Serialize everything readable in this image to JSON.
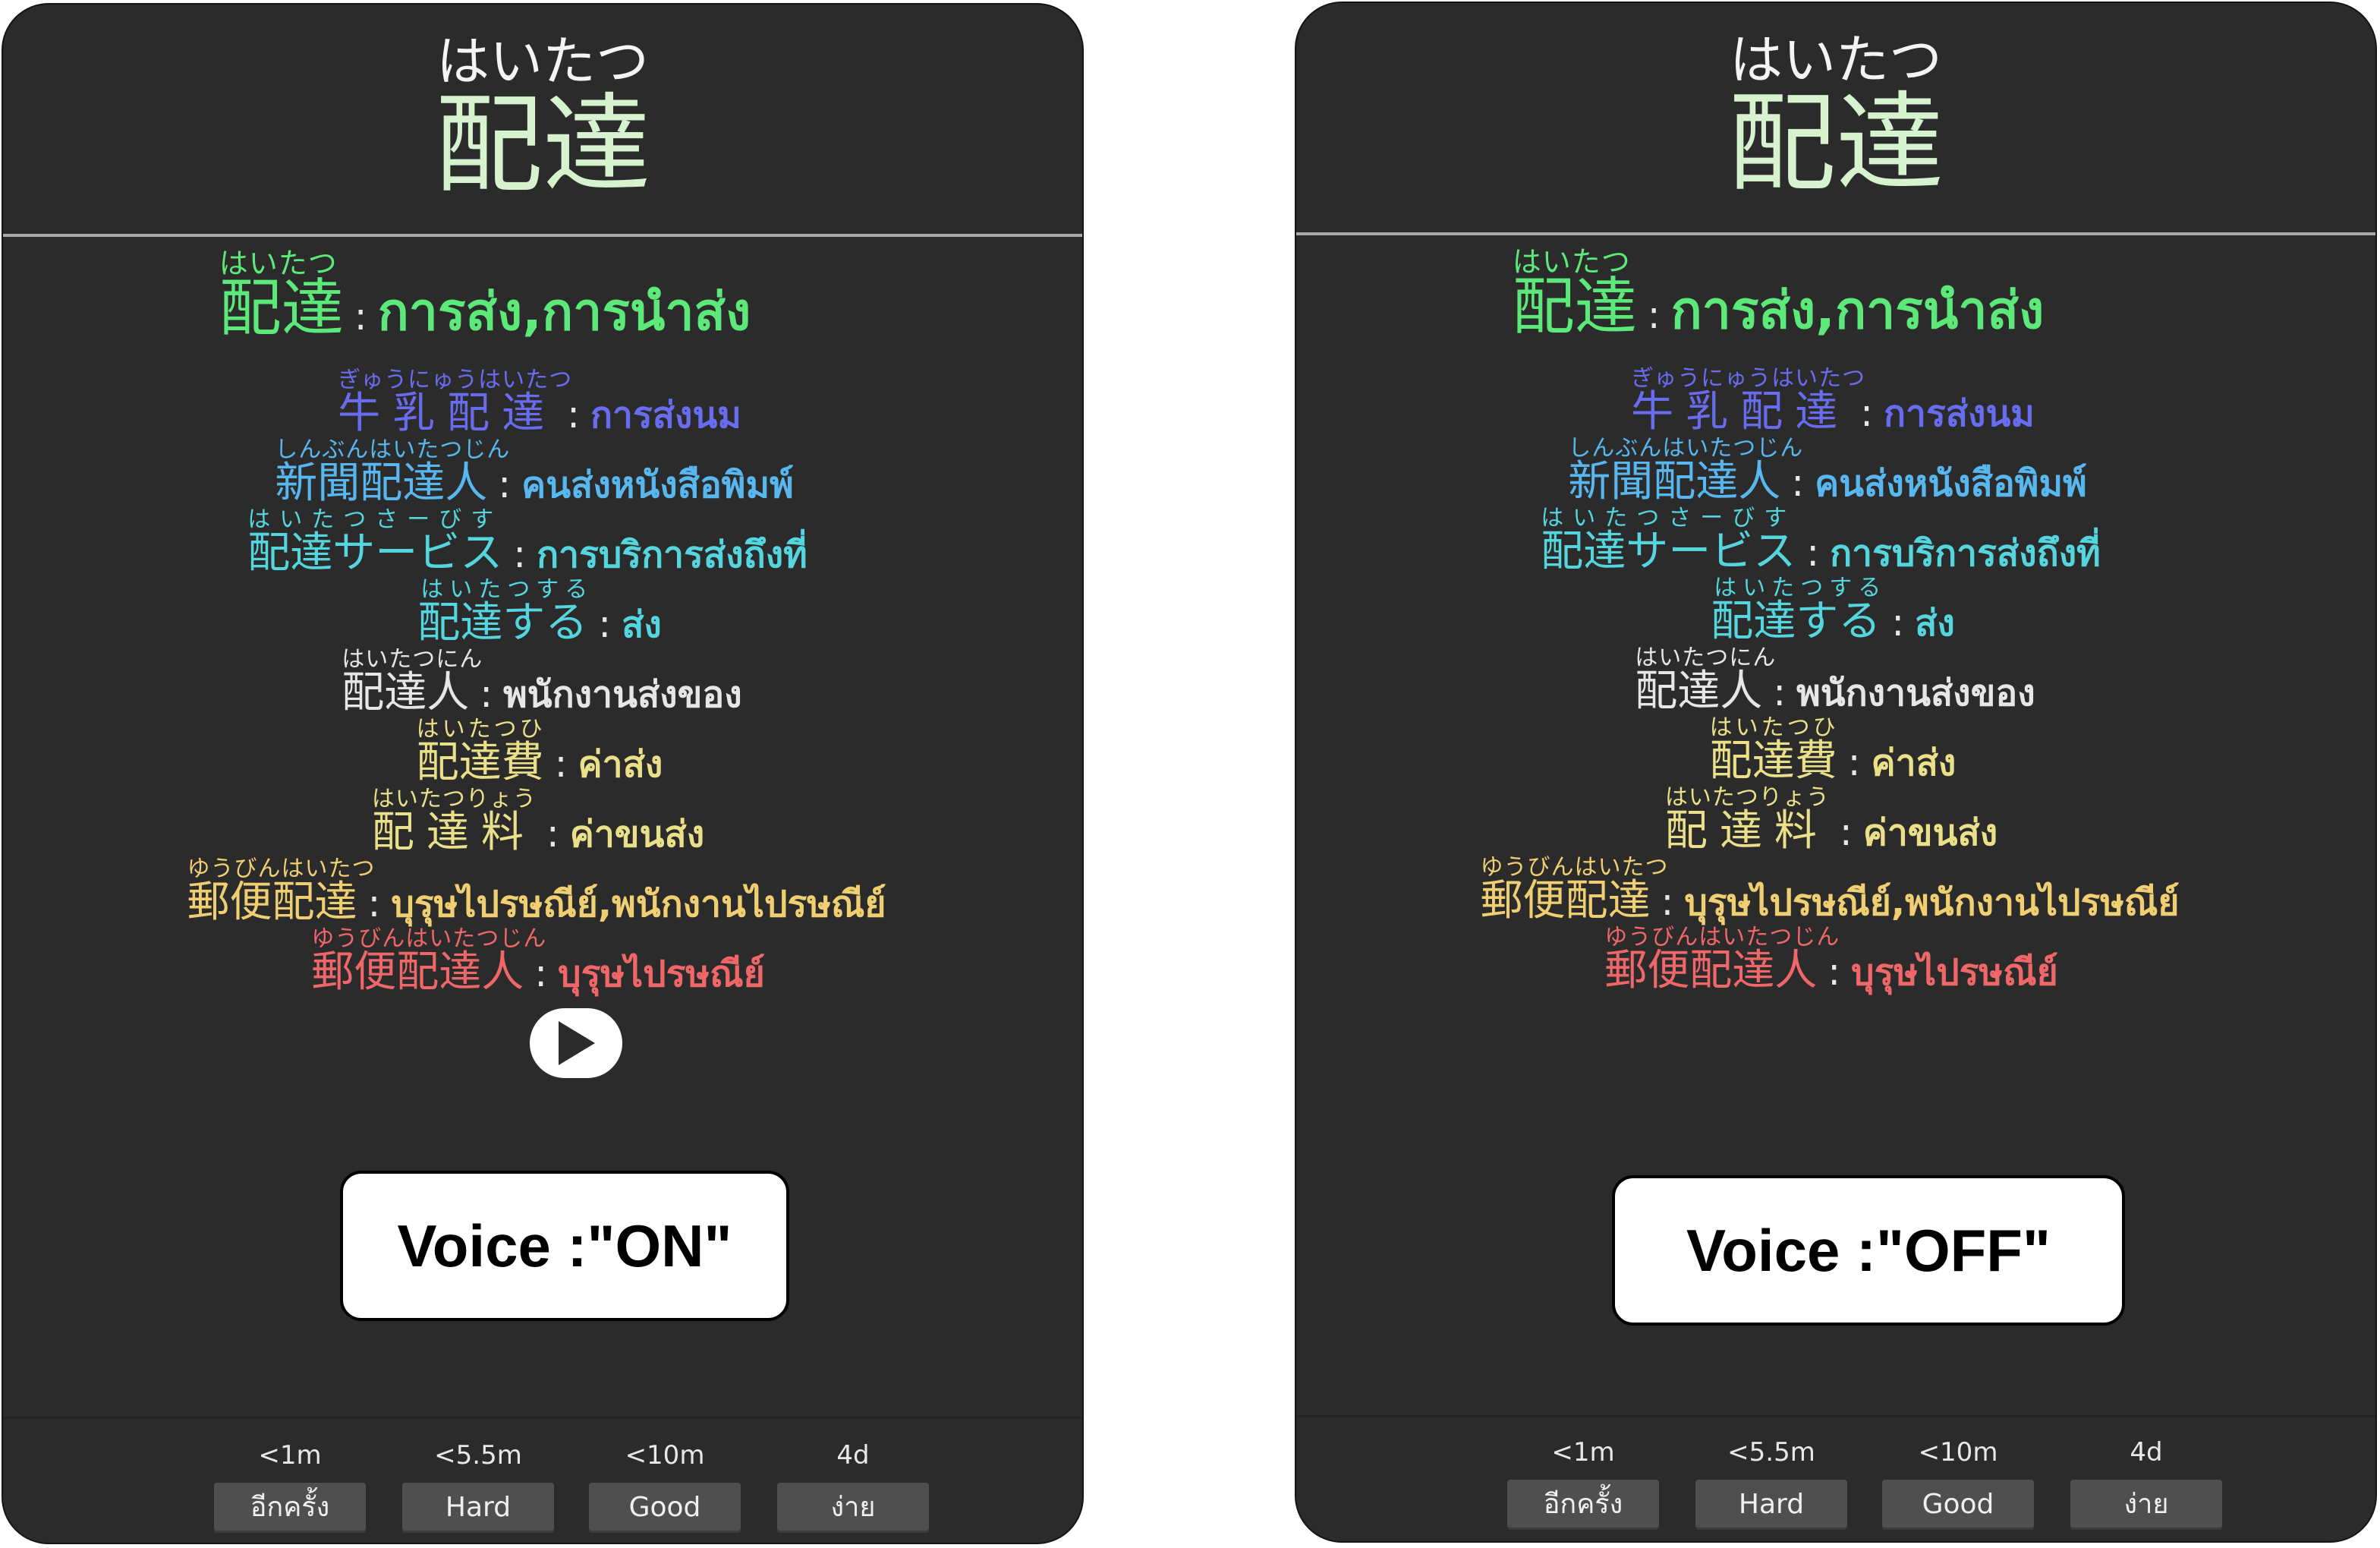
{
  "colors": {
    "card_bg": "#2b2b2c",
    "main_word": "#d6f2cf",
    "entry_green": "#5de87a",
    "entry_blue": "#6a6cf0",
    "entry_sky": "#58b7ee",
    "entry_cyan": "#55d6df",
    "entry_white": "#e6e6e6",
    "entry_yellow": "#eae08a",
    "entry_gold": "#f0cf72",
    "entry_red": "#f0676a"
  },
  "cards": [
    {
      "header": {
        "reading": "はいたつ",
        "word": "配達"
      },
      "entries": [
        {
          "ruby": "はいたつ",
          "word": "配達",
          "sep": ":",
          "meaning": "การส่ง,การนำส่ง"
        },
        {
          "ruby": "ぎゅうにゅうはいたつ",
          "word": "牛乳配達",
          "sep": ":",
          "meaning": "การส่งนม"
        },
        {
          "ruby": "しんぶんはいたつじん",
          "word": "新聞配達人",
          "sep": ":",
          "meaning": "คนส่งหนังสือพิมพ์"
        },
        {
          "ruby": "はいたつさーびす",
          "word": "配達サービス",
          "sep": ":",
          "meaning": "การบริการส่งถึงที่"
        },
        {
          "ruby": "はいたつする",
          "word": "配達する",
          "sep": ":",
          "meaning": "ส่ง"
        },
        {
          "ruby": "はいたつにん",
          "word": "配達人",
          "sep": ":",
          "meaning": "พนักงานส่งของ"
        },
        {
          "ruby": "はいたつひ",
          "word": "配達費",
          "sep": ":",
          "meaning": "ค่าส่ง"
        },
        {
          "ruby": "はいたつりょう",
          "word": "配達料",
          "sep": ":",
          "meaning": "ค่าขนส่ง"
        },
        {
          "ruby": "ゆうびんはいたつ",
          "word": "郵便配達",
          "sep": ":",
          "meaning": "บุรุษไปรษณีย์,พนักงานไปรษณีย์"
        },
        {
          "ruby": "ゆうびんはいたつじん",
          "word": "郵便配達人",
          "sep": ":",
          "meaning": "บุรุษไปรษณีย์"
        }
      ],
      "voice_label": "Voice :\"ON\"",
      "footer": [
        {
          "time": "<1m",
          "label": "อีกครั้ง"
        },
        {
          "time": "<5.5m",
          "label": "Hard"
        },
        {
          "time": "<10m",
          "label": "Good"
        },
        {
          "time": "4d",
          "label": "ง่าย"
        }
      ]
    },
    {
      "header": {
        "reading": "はいたつ",
        "word": "配達"
      },
      "entries": [
        {
          "ruby": "はいたつ",
          "word": "配達",
          "sep": ":",
          "meaning": "การส่ง,การนำส่ง"
        },
        {
          "ruby": "ぎゅうにゅうはいたつ",
          "word": "牛乳配達",
          "sep": ":",
          "meaning": "การส่งนม"
        },
        {
          "ruby": "しんぶんはいたつじん",
          "word": "新聞配達人",
          "sep": ":",
          "meaning": "คนส่งหนังสือพิมพ์"
        },
        {
          "ruby": "はいたつさーびす",
          "word": "配達サービス",
          "sep": ":",
          "meaning": "การบริการส่งถึงที่"
        },
        {
          "ruby": "はいたつする",
          "word": "配達する",
          "sep": ":",
          "meaning": "ส่ง"
        },
        {
          "ruby": "はいたつにん",
          "word": "配達人",
          "sep": ":",
          "meaning": "พนักงานส่งของ"
        },
        {
          "ruby": "はいたつひ",
          "word": "配達費",
          "sep": ":",
          "meaning": "ค่าส่ง"
        },
        {
          "ruby": "はいたつりょう",
          "word": "配達料",
          "sep": ":",
          "meaning": "ค่าขนส่ง"
        },
        {
          "ruby": "ゆうびんはいたつ",
          "word": "郵便配達",
          "sep": ":",
          "meaning": "บุรุษไปรษณีย์,พนักงานไปรษณีย์"
        },
        {
          "ruby": "ゆうびんはいたつじん",
          "word": "郵便配達人",
          "sep": ":",
          "meaning": "บุรุษไปรษณีย์"
        }
      ],
      "voice_label": "Voice :\"OFF\"",
      "footer": [
        {
          "time": "<1m",
          "label": "อีกครั้ง"
        },
        {
          "time": "<5.5m",
          "label": "Hard"
        },
        {
          "time": "<10m",
          "label": "Good"
        },
        {
          "time": "4d",
          "label": "ง่าย"
        }
      ]
    }
  ]
}
